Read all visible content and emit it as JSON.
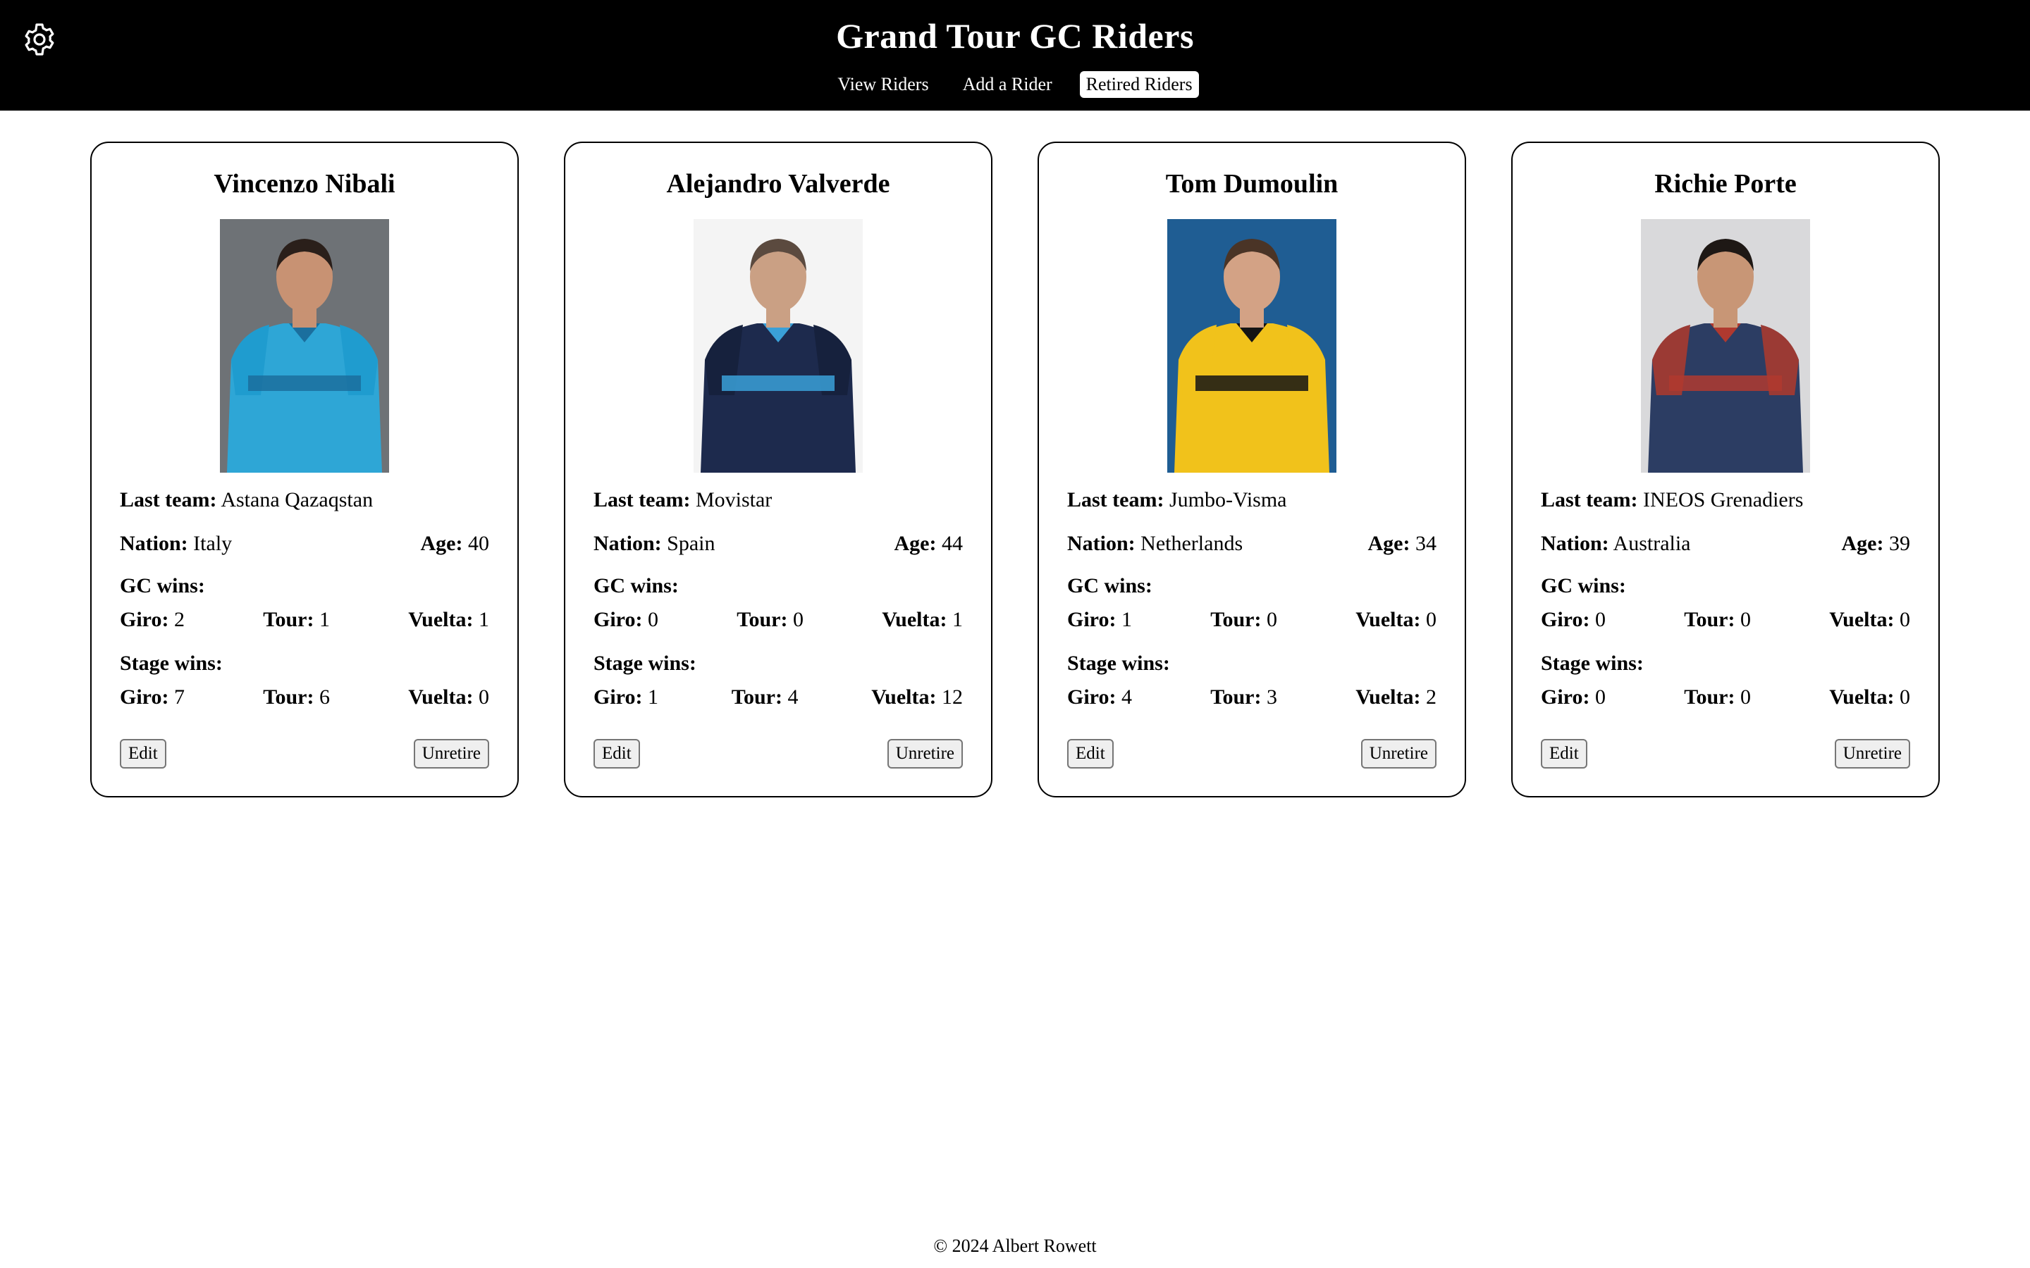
{
  "header": {
    "title": "Grand Tour GC Riders",
    "settings_icon": "gear-icon",
    "nav": [
      {
        "label": "View Riders",
        "active": false
      },
      {
        "label": "Add a Rider",
        "active": false
      },
      {
        "label": "Retired Riders",
        "active": true
      }
    ]
  },
  "labels": {
    "last_team": "Last team:",
    "nation": "Nation:",
    "age": "Age:",
    "gc_wins": "GC wins:",
    "stage_wins": "Stage wins:",
    "giro": "Giro:",
    "tour": "Tour:",
    "vuelta": "Vuelta:",
    "edit": "Edit",
    "unretire": "Unretire"
  },
  "riders": [
    {
      "name": "Vincenzo Nibali",
      "last_team": "Astana Qazaqstan",
      "nation": "Italy",
      "age": "40",
      "gc": {
        "giro": "2",
        "tour": "1",
        "vuelta": "1"
      },
      "stages": {
        "giro": "7",
        "tour": "6",
        "vuelta": "0"
      },
      "photo": {
        "bg": "#6e7276",
        "jersey": "#2ea6d6",
        "accent": "#1b6f9e",
        "sleeve": "#1f9ccf",
        "skin": "#c89273",
        "hair": "#2a1f1a"
      }
    },
    {
      "name": "Alejandro Valverde",
      "last_team": "Movistar",
      "nation": "Spain",
      "age": "44",
      "gc": {
        "giro": "0",
        "tour": "0",
        "vuelta": "1"
      },
      "stages": {
        "giro": "1",
        "tour": "4",
        "vuelta": "12"
      },
      "photo": {
        "bg": "#f4f4f4",
        "jersey": "#1d2a4d",
        "accent": "#3aa0d8",
        "sleeve": "#16213d",
        "skin": "#caa084",
        "hair": "#5b4a3f"
      }
    },
    {
      "name": "Tom Dumoulin",
      "last_team": "Jumbo-Visma",
      "nation": "Netherlands",
      "age": "34",
      "gc": {
        "giro": "1",
        "tour": "0",
        "vuelta": "0"
      },
      "stages": {
        "giro": "4",
        "tour": "3",
        "vuelta": "2"
      },
      "photo": {
        "bg": "#1f5d93",
        "jersey": "#f1c21b",
        "accent": "#141414",
        "sleeve": "#f1c21b",
        "skin": "#d3a285",
        "hair": "#4a3426"
      }
    },
    {
      "name": "Richie Porte",
      "last_team": "INEOS Grenadiers",
      "nation": "Australia",
      "age": "39",
      "gc": {
        "giro": "0",
        "tour": "0",
        "vuelta": "0"
      },
      "stages": {
        "giro": "0",
        "tour": "0",
        "vuelta": "0"
      },
      "photo": {
        "bg": "#d9d9db",
        "jersey": "#2c3d63",
        "accent": "#b0392f",
        "sleeve": "#9b3a34",
        "skin": "#c89676",
        "hair": "#1e1815"
      }
    }
  ],
  "footer": {
    "text": "© 2024 Albert Rowett"
  }
}
